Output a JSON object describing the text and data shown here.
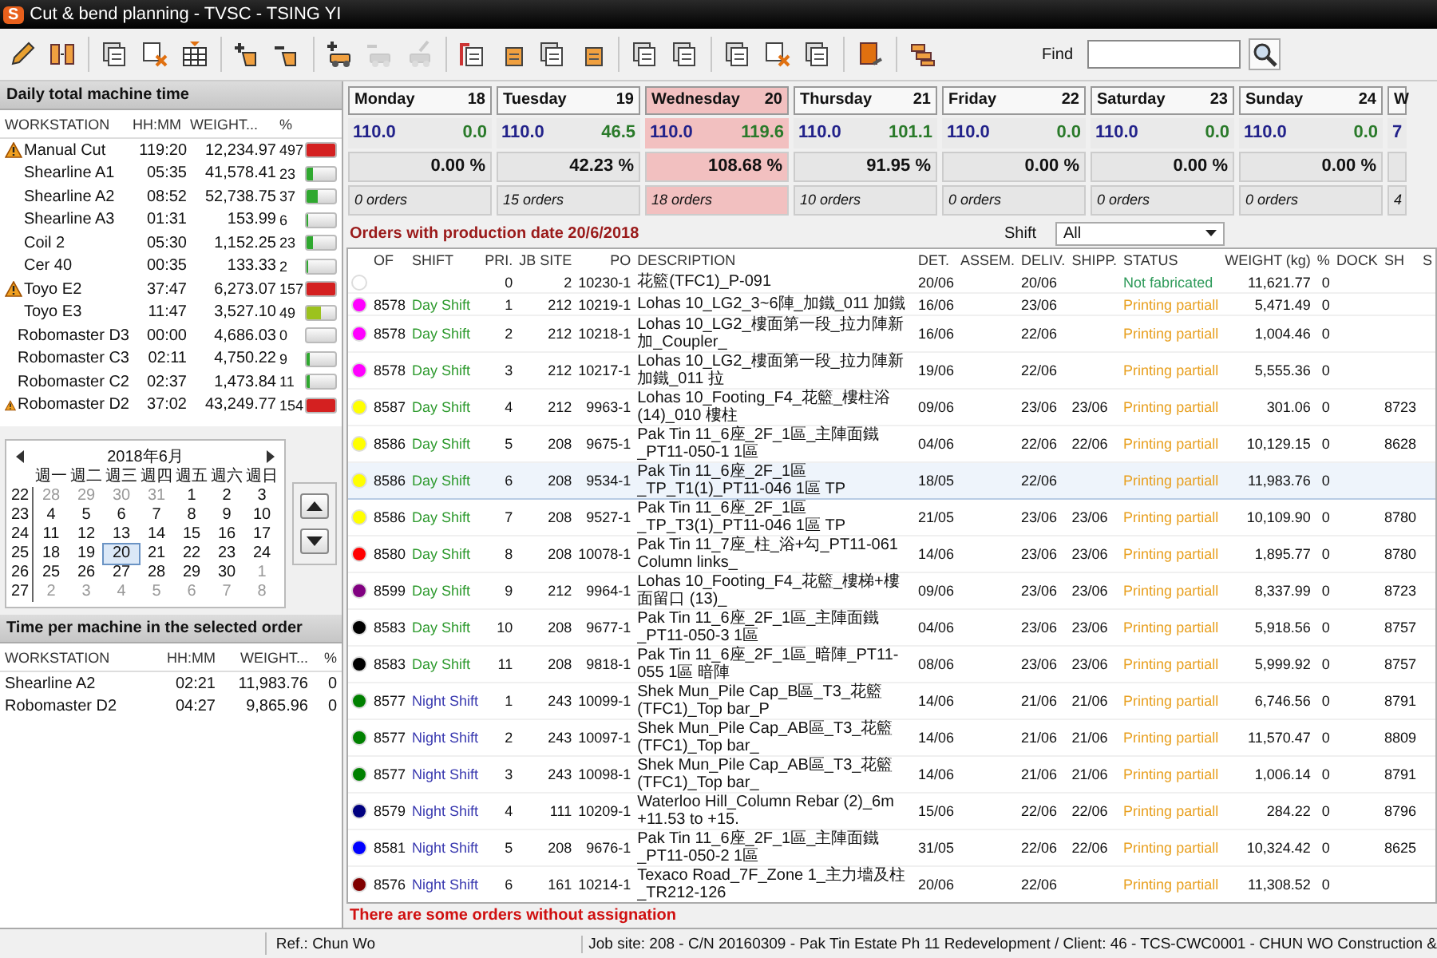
{
  "window": {
    "logo": "S",
    "title": "Cut & bend planning - TVSC - TSING YI"
  },
  "toolbar": [
    [
      {
        "kind": "pencil",
        "disabled": false
      },
      {
        "kind": "split",
        "disabled": false
      }
    ],
    [
      {
        "kind": "pages",
        "disabled": false
      },
      {
        "kind": "pages-x",
        "disabled": false
      },
      {
        "kind": "grid",
        "disabled": false
      }
    ],
    [
      {
        "kind": "plus-shape",
        "disabled": false
      },
      {
        "kind": "minus-shape",
        "disabled": false
      }
    ],
    [
      {
        "kind": "plus-truck",
        "disabled": false
      },
      {
        "kind": "minus-truck",
        "disabled": true
      },
      {
        "kind": "pencil-truck",
        "disabled": true
      }
    ],
    [
      {
        "kind": "flag-page",
        "disabled": false
      },
      {
        "kind": "page",
        "disabled": false
      },
      {
        "kind": "pages",
        "disabled": false
      },
      {
        "kind": "page",
        "disabled": false
      }
    ],
    [
      {
        "kind": "pages",
        "disabled": false
      },
      {
        "kind": "pages",
        "disabled": false
      }
    ],
    [
      {
        "kind": "pages",
        "disabled": false
      },
      {
        "kind": "pages-x",
        "disabled": false
      },
      {
        "kind": "pages",
        "disabled": false
      }
    ],
    [
      {
        "kind": "book",
        "disabled": false
      }
    ],
    [
      {
        "kind": "steps",
        "disabled": false
      }
    ]
  ],
  "find": {
    "label": "Find"
  },
  "machine_panel": {
    "title": "Daily total machine time",
    "columns": [
      "WORKSTATION",
      "HH:MM",
      "WEIGHT...",
      "%"
    ],
    "rows": [
      {
        "name": "Manual Cut",
        "time": "119:20",
        "weight": "12,234.97",
        "pct": "497",
        "level": 1,
        "warning": true
      },
      {
        "name": "Shearline A1",
        "time": "05:35",
        "weight": "41,578.41",
        "pct": "23",
        "level": 0.23,
        "warning": false
      },
      {
        "name": "Shearline A2",
        "time": "08:52",
        "weight": "52,738.75",
        "pct": "37",
        "level": 0.37,
        "warning": false
      },
      {
        "name": "Shearline A3",
        "time": "01:31",
        "weight": "153.99",
        "pct": "6",
        "level": 0.06,
        "warning": false
      },
      {
        "name": "Coil 2",
        "time": "05:30",
        "weight": "1,152.25",
        "pct": "23",
        "level": 0.23,
        "warning": false
      },
      {
        "name": "Cer 40",
        "time": "00:35",
        "weight": "133.33",
        "pct": "2",
        "level": 0.02,
        "warning": false
      },
      {
        "name": "Toyo E2",
        "time": "37:47",
        "weight": "6,273.07",
        "pct": "157",
        "level": 1,
        "warning": true
      },
      {
        "name": "Toyo E3",
        "time": "11:47",
        "weight": "3,527.10",
        "pct": "49",
        "level": 0.49,
        "warning": false
      },
      {
        "name": "Robomaster D3",
        "time": "00:00",
        "weight": "4,686.03",
        "pct": "0",
        "level": 0,
        "warning": false
      },
      {
        "name": "Robomaster C3",
        "time": "02:11",
        "weight": "4,750.22",
        "pct": "9",
        "level": 0.09,
        "warning": false
      },
      {
        "name": "Robomaster C2",
        "time": "02:37",
        "weight": "1,473.84",
        "pct": "11",
        "level": 0.11,
        "warning": false
      },
      {
        "name": "Robomaster D2",
        "time": "37:02",
        "weight": "43,249.77",
        "pct": "154",
        "level": 1,
        "warning": true
      }
    ]
  },
  "calendar": {
    "month": "2018年6月",
    "weekdays": [
      "週一",
      "週二",
      "週三",
      "週四",
      "週五",
      "週六",
      "週日"
    ],
    "weeks": [
      {
        "week": "22",
        "days": [
          {
            "d": "28",
            "outside": true,
            "selected": false
          },
          {
            "d": "29",
            "outside": true,
            "selected": false
          },
          {
            "d": "30",
            "outside": true,
            "selected": false
          },
          {
            "d": "31",
            "outside": true,
            "selected": false
          },
          {
            "d": "1",
            "outside": false,
            "selected": false
          },
          {
            "d": "2",
            "outside": false,
            "selected": false
          },
          {
            "d": "3",
            "outside": false,
            "selected": false
          }
        ]
      },
      {
        "week": "23",
        "days": [
          {
            "d": "4",
            "outside": false,
            "selected": false
          },
          {
            "d": "5",
            "outside": false,
            "selected": false
          },
          {
            "d": "6",
            "outside": false,
            "selected": false
          },
          {
            "d": "7",
            "outside": false,
            "selected": false
          },
          {
            "d": "8",
            "outside": false,
            "selected": false
          },
          {
            "d": "9",
            "outside": false,
            "selected": false
          },
          {
            "d": "10",
            "outside": false,
            "selected": false
          }
        ]
      },
      {
        "week": "24",
        "days": [
          {
            "d": "11",
            "outside": false,
            "selected": false
          },
          {
            "d": "12",
            "outside": false,
            "selected": false
          },
          {
            "d": "13",
            "outside": false,
            "selected": false
          },
          {
            "d": "14",
            "outside": false,
            "selected": false
          },
          {
            "d": "15",
            "outside": false,
            "selected": false
          },
          {
            "d": "16",
            "outside": false,
            "selected": false
          },
          {
            "d": "17",
            "outside": false,
            "selected": false
          }
        ]
      },
      {
        "week": "25",
        "days": [
          {
            "d": "18",
            "outside": false,
            "selected": false
          },
          {
            "d": "19",
            "outside": false,
            "selected": false
          },
          {
            "d": "20",
            "outside": false,
            "selected": true
          },
          {
            "d": "21",
            "outside": false,
            "selected": false
          },
          {
            "d": "22",
            "outside": false,
            "selected": false
          },
          {
            "d": "23",
            "outside": false,
            "selected": false
          },
          {
            "d": "24",
            "outside": false,
            "selected": false
          }
        ]
      },
      {
        "week": "26",
        "days": [
          {
            "d": "25",
            "outside": false,
            "selected": false
          },
          {
            "d": "26",
            "outside": false,
            "selected": false
          },
          {
            "d": "27",
            "outside": false,
            "selected": false
          },
          {
            "d": "28",
            "outside": false,
            "selected": false
          },
          {
            "d": "29",
            "outside": false,
            "selected": false
          },
          {
            "d": "30",
            "outside": false,
            "selected": false
          },
          {
            "d": "1",
            "outside": true,
            "selected": false
          }
        ]
      },
      {
        "week": "27",
        "days": [
          {
            "d": "2",
            "outside": true,
            "selected": false
          },
          {
            "d": "3",
            "outside": true,
            "selected": false
          },
          {
            "d": "4",
            "outside": true,
            "selected": false
          },
          {
            "d": "5",
            "outside": true,
            "selected": false
          },
          {
            "d": "6",
            "outside": true,
            "selected": false
          },
          {
            "d": "7",
            "outside": true,
            "selected": false
          },
          {
            "d": "8",
            "outside": true,
            "selected": false
          }
        ]
      }
    ]
  },
  "order_machine_panel": {
    "title": "Time per machine in the selected order",
    "columns": [
      "WORKSTATION",
      "HH:MM",
      "WEIGHT...",
      "%"
    ],
    "rows": [
      {
        "name": "Shearline A2",
        "time": "02:21",
        "weight": "11,983.76",
        "pct": "0"
      },
      {
        "name": "Robomaster D2",
        "time": "04:27",
        "weight": "9,865.96",
        "pct": "0"
      }
    ]
  },
  "days": [
    {
      "day": "Monday",
      "date": "18",
      "capacity": "110.0",
      "load": "0.0",
      "percent": "0.00 %",
      "orders": "0 orders",
      "selected": false
    },
    {
      "day": "Tuesday",
      "date": "19",
      "capacity": "110.0",
      "load": "46.5",
      "percent": "42.23 %",
      "orders": "15 orders",
      "selected": false
    },
    {
      "day": "Wednesday",
      "date": "20",
      "capacity": "110.0",
      "load": "119.6",
      "percent": "108.68 %",
      "orders": "18 orders",
      "selected": true
    },
    {
      "day": "Thursday",
      "date": "21",
      "capacity": "110.0",
      "load": "101.1",
      "percent": "91.95 %",
      "orders": "10 orders",
      "selected": false
    },
    {
      "day": "Friday",
      "date": "22",
      "capacity": "110.0",
      "load": "0.0",
      "percent": "0.00 %",
      "orders": "0 orders",
      "selected": false
    },
    {
      "day": "Saturday",
      "date": "23",
      "capacity": "110.0",
      "load": "0.0",
      "percent": "0.00 %",
      "orders": "0 orders",
      "selected": false
    },
    {
      "day": "Sunday",
      "date": "24",
      "capacity": "110.0",
      "load": "0.0",
      "percent": "0.00 %",
      "orders": "0 orders",
      "selected": false
    }
  ],
  "next_day_partial": {
    "day": "W",
    "capacity": "7",
    "orders": "4"
  },
  "orders": {
    "title": "Orders with production date 20/6/2018",
    "shift_label": "Shift",
    "shift_value": "All",
    "columns": [
      "OF",
      "SHIFT",
      "PRI.",
      "JB SITE",
      "PO",
      "DESCRIPTION",
      "DET.",
      "ASSEM.",
      "DELIV.",
      "SHIPP.",
      "STATUS",
      "WEIGHT (kg)",
      "%",
      "DOCK",
      "SH",
      "S"
    ],
    "rows": [
      {
        "color": "#ffffff",
        "of": "",
        "pri": "0",
        "site": "2",
        "po": "10230-1",
        "desc": "花籃(TFC1)_P-091",
        "det": "20/06",
        "deliv": "20/06",
        "shipp": "",
        "status": {
          "text": "Not fabricated",
          "kind": "not_fabricated"
        },
        "weight": "11,621.77",
        "pct": "0",
        "sh": "",
        "selected": false
      },
      {
        "color": "#ff00ff",
        "of": "8578",
        "shift": {
          "text": "Day Shift",
          "kind": "day"
        },
        "pri": "1",
        "site": "212",
        "po": "10219-1",
        "desc": "Lohas 10_LG2_3~6陣_加鐵_011 加鐵",
        "det": "16/06",
        "deliv": "23/06",
        "shipp": "",
        "status": {
          "text": "Printing partiall",
          "kind": "printing"
        },
        "weight": "5,471.49",
        "pct": "0",
        "sh": "",
        "selected": false
      },
      {
        "color": "#ff00ff",
        "of": "8578",
        "shift": {
          "text": "Day Shift",
          "kind": "day"
        },
        "pri": "2",
        "site": "212",
        "po": "10218-1",
        "desc": "Lohas 10_LG2_樓面第一段_拉力陣新加_Coupler_",
        "det": "16/06",
        "deliv": "22/06",
        "shipp": "",
        "status": {
          "text": "Printing partiall",
          "kind": "printing"
        },
        "weight": "1,004.46",
        "pct": "0",
        "sh": "",
        "selected": false
      },
      {
        "color": "#ff00ff",
        "of": "8578",
        "shift": {
          "text": "Day Shift",
          "kind": "day"
        },
        "pri": "3",
        "site": "212",
        "po": "10217-1",
        "desc": "Lohas 10_LG2_樓面第一段_拉力陣新加鐵_011 拉",
        "det": "19/06",
        "deliv": "22/06",
        "shipp": "",
        "status": {
          "text": "Printing partiall",
          "kind": "printing"
        },
        "weight": "5,555.36",
        "pct": "0",
        "sh": "",
        "selected": false
      },
      {
        "color": "#ffff00",
        "of": "8587",
        "shift": {
          "text": "Day Shift",
          "kind": "day"
        },
        "pri": "4",
        "site": "212",
        "po": "9963-1",
        "desc": "Lohas 10_Footing_F4_花籃_樓柱浴 (14)_010 樓柱",
        "det": "09/06",
        "deliv": "23/06",
        "shipp": "23/06",
        "status": {
          "text": "Printing partiall",
          "kind": "printing"
        },
        "weight": "301.06",
        "pct": "0",
        "sh": "8723",
        "selected": false
      },
      {
        "color": "#ffff00",
        "of": "8586",
        "shift": {
          "text": "Day Shift",
          "kind": "day"
        },
        "pri": "5",
        "site": "208",
        "po": "9675-1",
        "desc": "Pak Tin 11_6座_2F_1區_主陣面鐵_PT11-050-1 1區",
        "det": "04/06",
        "deliv": "22/06",
        "shipp": "22/06",
        "status": {
          "text": "Printing partiall",
          "kind": "printing"
        },
        "weight": "10,129.15",
        "pct": "0",
        "sh": "8628",
        "selected": false
      },
      {
        "color": "#ffff00",
        "of": "8586",
        "shift": {
          "text": "Day Shift",
          "kind": "day"
        },
        "pri": "6",
        "site": "208",
        "po": "9534-1",
        "desc": "Pak Tin 11_6座_2F_1區_TP_T1(1)_PT11-046 1區 TP",
        "det": "18/05",
        "deliv": "22/06",
        "shipp": "",
        "status": {
          "text": "Printing partiall",
          "kind": "printing"
        },
        "weight": "11,983.76",
        "pct": "0",
        "sh": "",
        "selected": true
      },
      {
        "color": "#ffff00",
        "of": "8586",
        "shift": {
          "text": "Day Shift",
          "kind": "day"
        },
        "pri": "7",
        "site": "208",
        "po": "9527-1",
        "desc": "Pak Tin 11_6座_2F_1區_TP_T3(1)_PT11-046 1區 TP",
        "det": "21/05",
        "deliv": "23/06",
        "shipp": "23/06",
        "status": {
          "text": "Printing partiall",
          "kind": "printing"
        },
        "weight": "10,109.90",
        "pct": "0",
        "sh": "8780",
        "selected": false
      },
      {
        "color": "#ff0000",
        "of": "8580",
        "shift": {
          "text": "Day Shift",
          "kind": "day"
        },
        "pri": "8",
        "site": "208",
        "po": "10078-1",
        "desc": "Pak Tin 11_7座_柱_浴+勾_PT11-061 Column links_",
        "det": "14/06",
        "deliv": "23/06",
        "shipp": "23/06",
        "status": {
          "text": "Printing partiall",
          "kind": "printing"
        },
        "weight": "1,895.77",
        "pct": "0",
        "sh": "8780",
        "selected": false
      },
      {
        "color": "#800080",
        "of": "8599",
        "shift": {
          "text": "Day Shift",
          "kind": "day"
        },
        "pri": "9",
        "site": "212",
        "po": "9964-1",
        "desc": "Lohas 10_Footing_F4_花籃_樓梯+樓面留口 (13)_",
        "det": "09/06",
        "deliv": "23/06",
        "shipp": "23/06",
        "status": {
          "text": "Printing partiall",
          "kind": "printing"
        },
        "weight": "8,337.99",
        "pct": "0",
        "sh": "8723",
        "selected": false
      },
      {
        "color": "#000000",
        "of": "8583",
        "shift": {
          "text": "Day Shift",
          "kind": "day"
        },
        "pri": "10",
        "site": "208",
        "po": "9677-1",
        "desc": "Pak Tin 11_6座_2F_1區_主陣面鐵_PT11-050-3 1區",
        "det": "04/06",
        "deliv": "23/06",
        "shipp": "23/06",
        "status": {
          "text": "Printing partiall",
          "kind": "printing"
        },
        "weight": "5,918.56",
        "pct": "0",
        "sh": "8757",
        "selected": false
      },
      {
        "color": "#000000",
        "of": "8583",
        "shift": {
          "text": "Day Shift",
          "kind": "day"
        },
        "pri": "11",
        "site": "208",
        "po": "9818-1",
        "desc": "Pak Tin 11_6座_2F_1區_暗陣_PT11-055 1區 暗陣",
        "det": "08/06",
        "deliv": "23/06",
        "shipp": "23/06",
        "status": {
          "text": "Printing partiall",
          "kind": "printing"
        },
        "weight": "5,999.92",
        "pct": "0",
        "sh": "8757",
        "selected": false
      },
      {
        "color": "#008000",
        "of": "8577",
        "shift": {
          "text": "Night Shift",
          "kind": "night"
        },
        "pri": "1",
        "site": "243",
        "po": "10099-1",
        "desc": "Shek Mun_Pile Cap_B區_T3_花籃(TFC1)_Top bar_P",
        "det": "14/06",
        "deliv": "21/06",
        "shipp": "21/06",
        "status": {
          "text": "Printing partiall",
          "kind": "printing"
        },
        "weight": "6,746.56",
        "pct": "0",
        "sh": "8791",
        "selected": false
      },
      {
        "color": "#008000",
        "of": "8577",
        "shift": {
          "text": "Night Shift",
          "kind": "night"
        },
        "pri": "2",
        "site": "243",
        "po": "10097-1",
        "desc": "Shek Mun_Pile Cap_AB區_T3_花籃(TFC1)_Top bar_",
        "det": "14/06",
        "deliv": "21/06",
        "shipp": "21/06",
        "status": {
          "text": "Printing partiall",
          "kind": "printing"
        },
        "weight": "11,570.47",
        "pct": "0",
        "sh": "8809",
        "selected": false
      },
      {
        "color": "#008000",
        "of": "8577",
        "shift": {
          "text": "Night Shift",
          "kind": "night"
        },
        "pri": "3",
        "site": "243",
        "po": "10098-1",
        "desc": "Shek Mun_Pile Cap_AB區_T3_花籃(TFC1)_Top bar_",
        "det": "14/06",
        "deliv": "21/06",
        "shipp": "21/06",
        "status": {
          "text": "Printing partiall",
          "kind": "printing"
        },
        "weight": "1,006.14",
        "pct": "0",
        "sh": "8791",
        "selected": false
      },
      {
        "color": "#000080",
        "of": "8579",
        "shift": {
          "text": "Night Shift",
          "kind": "night"
        },
        "pri": "4",
        "site": "111",
        "po": "10209-1",
        "desc": "Waterloo Hill_Column Rebar (2)_6m +11.53 to +15.",
        "det": "15/06",
        "deliv": "22/06",
        "shipp": "22/06",
        "status": {
          "text": "Printing partiall",
          "kind": "printing"
        },
        "weight": "284.22",
        "pct": "0",
        "sh": "8796",
        "selected": false
      },
      {
        "color": "#0000ff",
        "of": "8581",
        "shift": {
          "text": "Night Shift",
          "kind": "night"
        },
        "pri": "5",
        "site": "208",
        "po": "9676-1",
        "desc": "Pak Tin 11_6座_2F_1區_主陣面鐵_PT11-050-2 1區",
        "det": "31/05",
        "deliv": "22/06",
        "shipp": "22/06",
        "status": {
          "text": "Printing partiall",
          "kind": "printing"
        },
        "weight": "10,324.42",
        "pct": "0",
        "sh": "8625",
        "selected": false
      },
      {
        "color": "#800000",
        "of": "8576",
        "shift": {
          "text": "Night Shift",
          "kind": "night"
        },
        "pri": "6",
        "site": "161",
        "po": "10214-1",
        "desc": "Texaco Road_7F_Zone 1_主力墻及柱_TR212-126",
        "det": "20/06",
        "deliv": "22/06",
        "shipp": "",
        "status": {
          "text": "Printing partiall",
          "kind": "printing"
        },
        "weight": "11,308.52",
        "pct": "0",
        "sh": "",
        "selected": false
      }
    ],
    "warning": "There are some orders without assignation"
  },
  "status_bar": {
    "ref": "Ref.: Chun Wo",
    "job": "Job site: 208 - C/N 20160309 - Pak Tin Estate Ph 11 Redevelopment / Client: 46 - TCS-CWC0001 - CHUN WO Construction &"
  }
}
